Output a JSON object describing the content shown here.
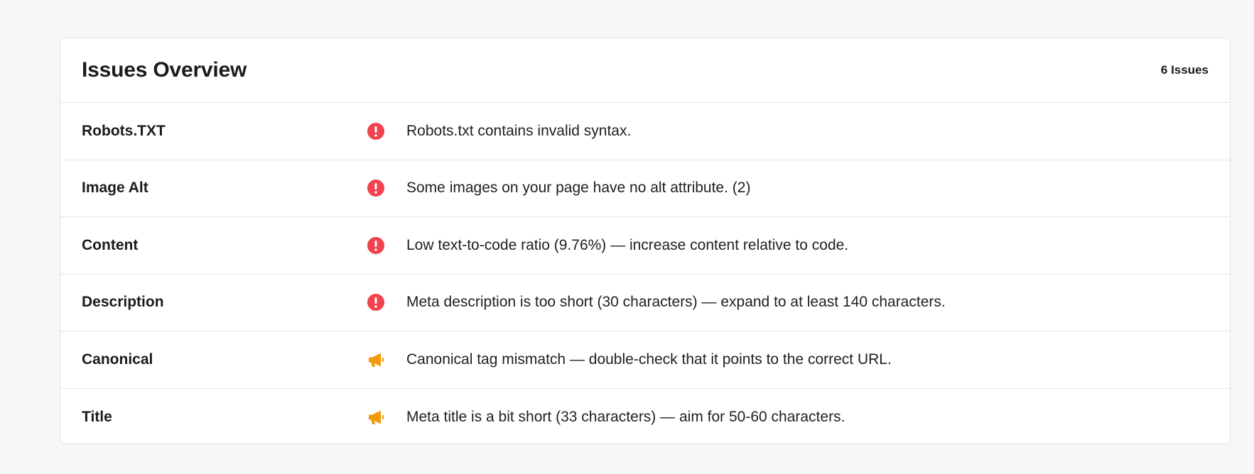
{
  "header": {
    "title": "Issues Overview",
    "count_label": "6 Issues"
  },
  "colors": {
    "error": "#f0424f",
    "warning": "#f39a0b"
  },
  "issues": [
    {
      "category": "Robots.TXT",
      "icon": "error-icon",
      "message": "Robots.txt contains invalid syntax."
    },
    {
      "category": "Image Alt",
      "icon": "error-icon",
      "message": "Some images on your page have no alt attribute. (2)"
    },
    {
      "category": "Content",
      "icon": "error-icon",
      "message": "Low text-to-code ratio (9.76%) — increase content relative to code."
    },
    {
      "category": "Description",
      "icon": "error-icon",
      "message": "Meta description is too short (30 characters) — expand to at least 140 characters."
    },
    {
      "category": "Canonical",
      "icon": "megaphone-icon",
      "message": "Canonical tag mismatch — double-check that it points to the correct URL."
    },
    {
      "category": "Title",
      "icon": "megaphone-icon",
      "message": "Meta title is a bit short (33 characters) — aim for 50-60 characters."
    }
  ]
}
